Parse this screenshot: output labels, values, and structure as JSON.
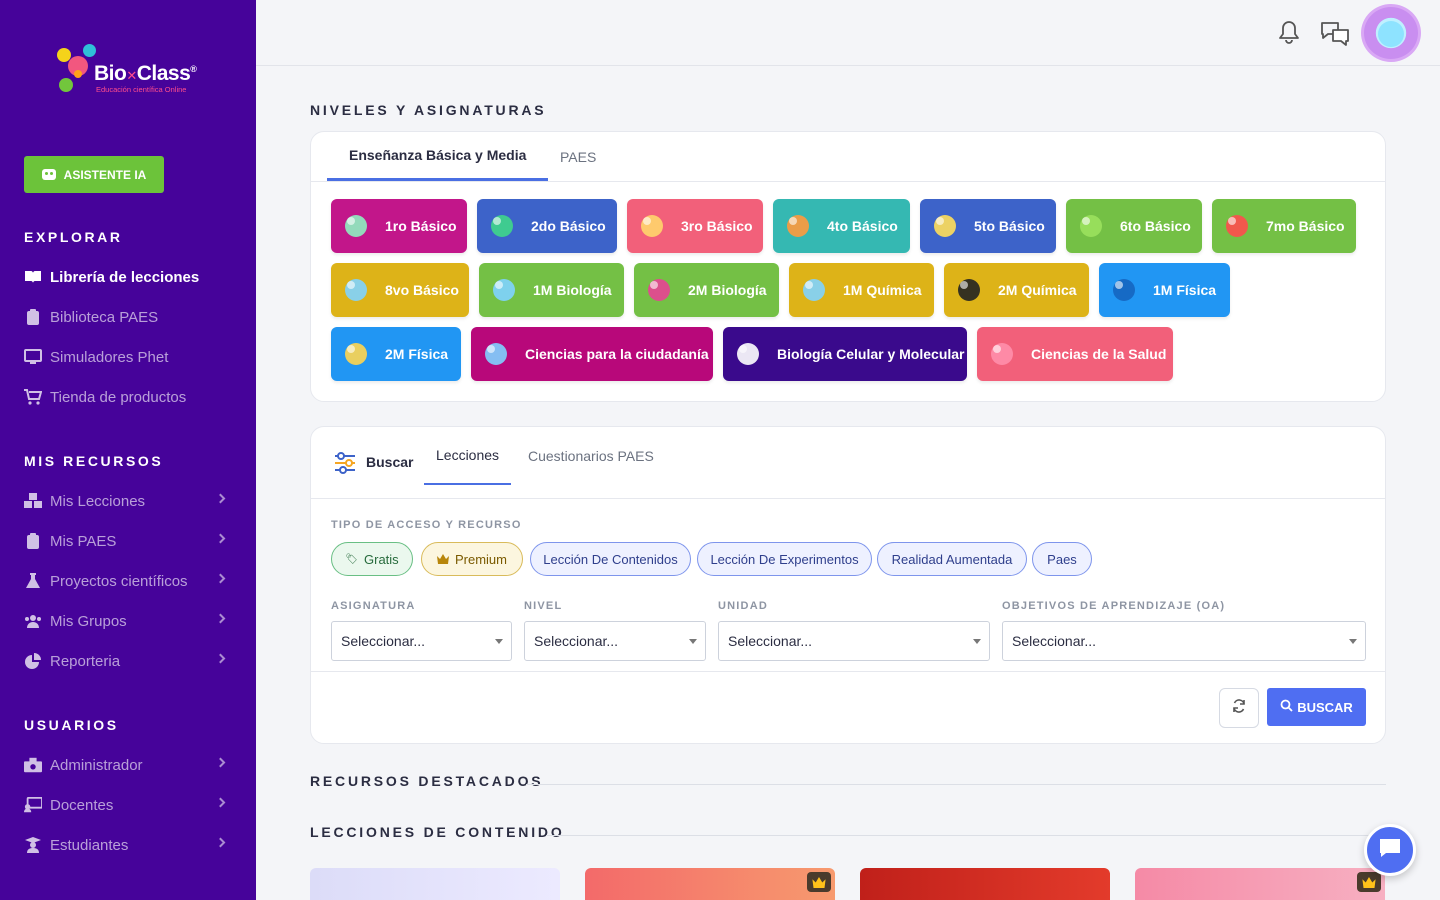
{
  "brand": {
    "name": "Bio",
    "name2": "Class",
    "tagline": "Educación científica Online"
  },
  "sidebar": {
    "ai_button": "ASISTENTE IA",
    "explore_title": "EXPLORAR",
    "explore": [
      {
        "label": "Librería de lecciones",
        "icon": "book-open-icon",
        "active": true
      },
      {
        "label": "Biblioteca PAES",
        "icon": "clipboard-icon"
      },
      {
        "label": "Simuladores Phet",
        "icon": "monitor-icon"
      },
      {
        "label": "Tienda de productos",
        "icon": "cart-icon"
      }
    ],
    "resources_title": "MIS RECURSOS",
    "resources": [
      {
        "label": "Mis Lecciones",
        "icon": "cubes-icon"
      },
      {
        "label": "Mis PAES",
        "icon": "clipboard-icon"
      },
      {
        "label": "Proyectos científicos",
        "icon": "flask-icon"
      },
      {
        "label": "Mis Grupos",
        "icon": "users-icon"
      },
      {
        "label": "Reporteria",
        "icon": "pie-chart-icon"
      }
    ],
    "users_title": "USUARIOS",
    "users": [
      {
        "label": "Administrador",
        "icon": "admin-icon"
      },
      {
        "label": "Docentes",
        "icon": "teacher-icon"
      },
      {
        "label": "Estudiantes",
        "icon": "student-icon"
      }
    ]
  },
  "header": {
    "notifications_icon": "bell-icon",
    "messages_icon": "chat-icon"
  },
  "levels_section": {
    "title": "NIVELES Y ASIGNATURAS",
    "tabs": [
      "Enseñanza Básica y Media",
      "PAES"
    ],
    "items": [
      {
        "label": "1ro Básico",
        "color": "#c2168a"
      },
      {
        "label": "2do Básico",
        "color": "#3d63c9"
      },
      {
        "label": "3ro Básico",
        "color": "#f2607a"
      },
      {
        "label": "4to Básico",
        "color": "#35b8b2"
      },
      {
        "label": "5to Básico",
        "color": "#3d63c9"
      },
      {
        "label": "6to Básico",
        "color": "#74c045"
      },
      {
        "label": "7mo Básico",
        "color": "#74c045"
      },
      {
        "label": "8vo Básico",
        "color": "#ddb318"
      },
      {
        "label": "1M Biología",
        "color": "#74c045"
      },
      {
        "label": "2M Biología",
        "color": "#74c045"
      },
      {
        "label": "1M Química",
        "color": "#ddb318"
      },
      {
        "label": "2M Química",
        "color": "#ddb318"
      },
      {
        "label": "1M Física",
        "color": "#2196f3"
      },
      {
        "label": "2M Física",
        "color": "#2196f3"
      },
      {
        "label": "Ciencias para la ciudadanía",
        "color": "#b8087a"
      },
      {
        "label": "Biología Celular y Molecular",
        "color": "#3a0a8c"
      },
      {
        "label": "Ciencias de la Salud",
        "color": "#f2607a"
      }
    ]
  },
  "search_section": {
    "label": "Buscar",
    "tabs": [
      "Lecciones",
      "Cuestionarios PAES"
    ],
    "access_label": "TIPO DE ACCESO Y RECURSO",
    "chips": [
      "Gratis",
      "Premium",
      "Lección De Contenidos",
      "Lección De Experimentos",
      "Realidad Aumentada",
      "Paes"
    ],
    "filters": [
      {
        "label": "ASIGNATURA",
        "value": "Seleccionar..."
      },
      {
        "label": "NIVEL",
        "value": "Seleccionar..."
      },
      {
        "label": "UNIDAD",
        "value": "Seleccionar..."
      },
      {
        "label": "OBJETIVOS DE APRENDIZAJE (OA)",
        "value": "Seleccionar..."
      }
    ],
    "search_button": "BUSCAR"
  },
  "featured_title": "RECURSOS DESTACADOS",
  "content_title": "LECCIONES DE CONTENIDO"
}
